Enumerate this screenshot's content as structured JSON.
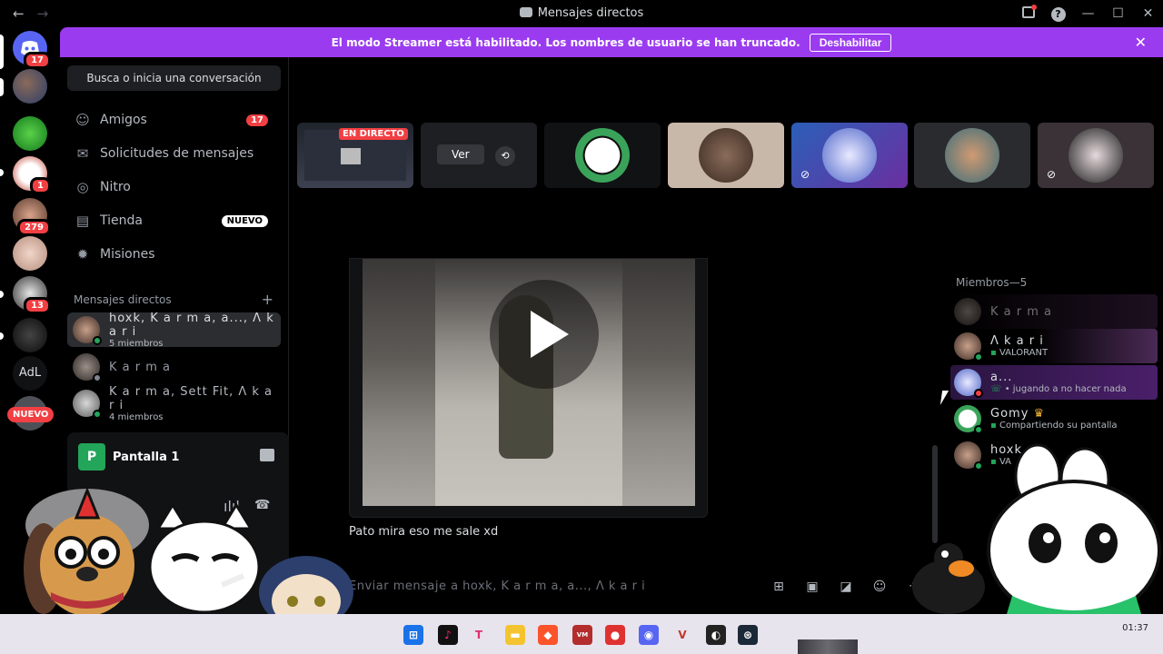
{
  "window": {
    "title": "Mensajes directos"
  },
  "banner": {
    "text": "El modo Streamer está habilitado. Los nombres de usuario se han truncado.",
    "disable_label": "Deshabilitar"
  },
  "guilds": {
    "badges": [
      "17",
      "1",
      "279",
      "13"
    ],
    "text_guild": "AdL",
    "new_label": "NUEVO"
  },
  "sidebar": {
    "search_label": "Busca o inicia una conversación",
    "nav": [
      {
        "label": "Amigos",
        "badge": "17"
      },
      {
        "label": "Solicitudes de mensajes"
      },
      {
        "label": "Nitro"
      },
      {
        "label": "Tienda",
        "tag": "NUEVO"
      },
      {
        "label": "Misiones"
      }
    ],
    "dm_header": "Mensajes directos",
    "dms": [
      {
        "name": "hoxk, K a r m a, a..., Λ k a r i",
        "sub": "5 miembros"
      },
      {
        "name": "K a r m a",
        "sub": ""
      },
      {
        "name": "K a r m a, Sett Fit, Λ k a r i",
        "sub": "4 miembros"
      }
    ]
  },
  "voice_panel": {
    "title": "Pantalla 1",
    "logo": "P"
  },
  "stage": {
    "live_label": "EN DIRECTO",
    "view_label": "Ver"
  },
  "chat": {
    "message": "Pato mira eso me sale xd",
    "composer_placeholder": "Enviar mensaje a hoxk, K a r m a, a..., Λ k a r i"
  },
  "members": {
    "header": "Miembros—5",
    "list": [
      {
        "name": "K a r m a",
        "activity": ""
      },
      {
        "name": "Λ k a r i",
        "activity": "VALORANT"
      },
      {
        "name": "a...",
        "activity": "• jugando a no hacer nada"
      },
      {
        "name": "Gomy",
        "activity": "Compartiendo su pantalla"
      },
      {
        "name": "hoxk",
        "activity": "VA"
      }
    ]
  },
  "taskbar": {
    "clock": "01:37"
  },
  "colors": {
    "accent": "#9b3bf0",
    "danger": "#f23f43",
    "online": "#23a55a",
    "blurple": "#5865f2"
  }
}
